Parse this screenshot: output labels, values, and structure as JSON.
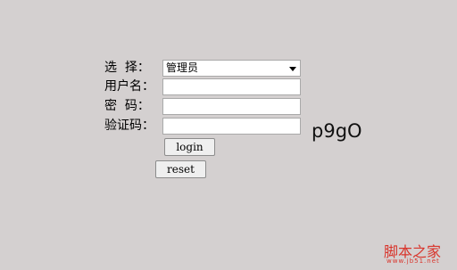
{
  "form": {
    "role_label": "选  择：",
    "role_selected": "管理员",
    "username_label": "用户名：",
    "username_value": "",
    "password_label": "密  码：",
    "password_value": "",
    "captcha_label": "验证码：",
    "captcha_value": "",
    "captcha_image_text": "p9gO",
    "login_label": "login",
    "reset_label": "reset"
  },
  "watermark": {
    "text": "脚本之家",
    "url": "www.jb51.net"
  },
  "colors": {
    "background": "#d4d0d0",
    "watermark": "#d9342b"
  }
}
